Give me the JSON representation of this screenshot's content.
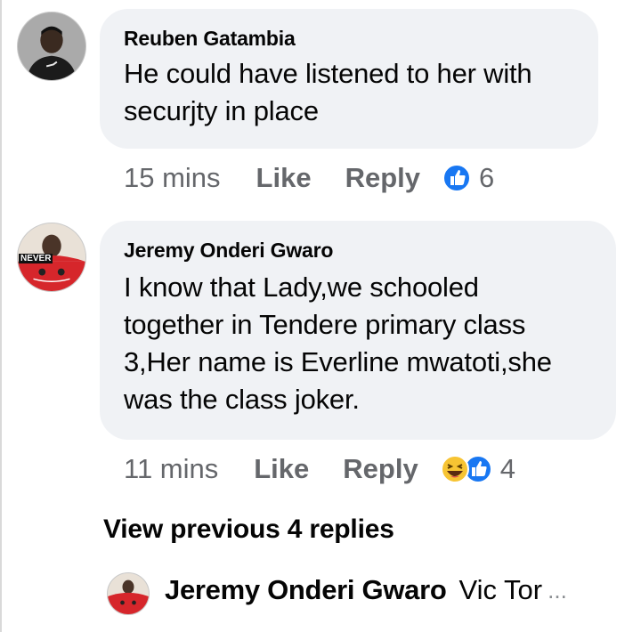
{
  "comments": [
    {
      "author": "Reuben Gatambia",
      "text": "He could have listened to her with\nsecurjty in place",
      "time": "15 mins",
      "like_label": "Like",
      "reply_label": "Reply",
      "reactions": [
        "like-icon"
      ],
      "reaction_count": "6"
    },
    {
      "author": "Jeremy Onderi Gwaro",
      "text": "I know that Lady,we schooled\ntogether in Tendere primary class\n3,Her name is Everline mwatoti,she\nwas the class joker.",
      "time": "11 mins",
      "like_label": "Like",
      "reply_label": "Reply",
      "reactions": [
        "haha-icon",
        "like-icon"
      ],
      "reaction_count": "4",
      "avatar_text": "NEVER"
    }
  ],
  "view_previous": "View previous 4 replies",
  "preview": {
    "author": "Jeremy Onderi Gwaro",
    "text": "Vic Tor",
    "ellipsis": "..."
  },
  "colors": {
    "bubble": "#f0f2f5",
    "meta_text": "#65676b",
    "like_blue": "#1877f2",
    "haha_yellow": "#f7c433"
  }
}
